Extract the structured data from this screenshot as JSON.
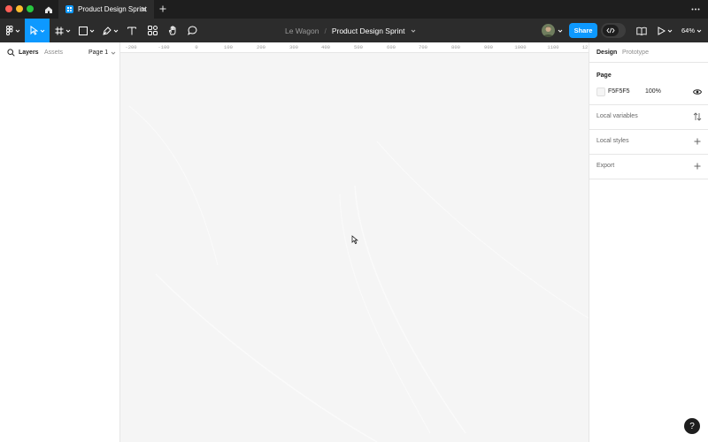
{
  "colors": {
    "accent": "#0d99ff",
    "close": "#ff5f57",
    "minimize": "#febc2e",
    "maximize": "#28c840",
    "canvas_bg": "#f5f5f5"
  },
  "tabbar": {
    "tab_title": "Product Design Sprint",
    "tab_icon": "figma-file-icon",
    "new_tab_icon": "plus-icon",
    "more_icon": "more-dots-icon"
  },
  "toolbar": {
    "tools": [
      "main-menu",
      "move-tool",
      "frame-tool",
      "shape-tool",
      "pen-tool",
      "text-tool",
      "resources-tool",
      "hand-tool",
      "comment-tool"
    ],
    "active_tool": "move-tool",
    "breadcrumb": {
      "team": "Le Wagon",
      "separator": "/",
      "file": "Product Design Sprint"
    },
    "share_label": "Share",
    "zoom_label": "64%"
  },
  "left_panel": {
    "tabs": [
      "Layers",
      "Assets"
    ],
    "page_selector": "Page 1"
  },
  "ruler": {
    "labels": [
      "-200",
      "-100",
      "0",
      "100",
      "200",
      "300",
      "400",
      "500",
      "600",
      "700",
      "800",
      "900",
      "1000",
      "1100",
      "12"
    ]
  },
  "right_panel": {
    "tabs": [
      "Design",
      "Prototype"
    ],
    "page_section": {
      "title": "Page",
      "fill_hex": "F5F5F5",
      "fill_opacity": "100%"
    },
    "rows": [
      "Local variables",
      "Local styles",
      "Export"
    ]
  },
  "help_label": "?"
}
